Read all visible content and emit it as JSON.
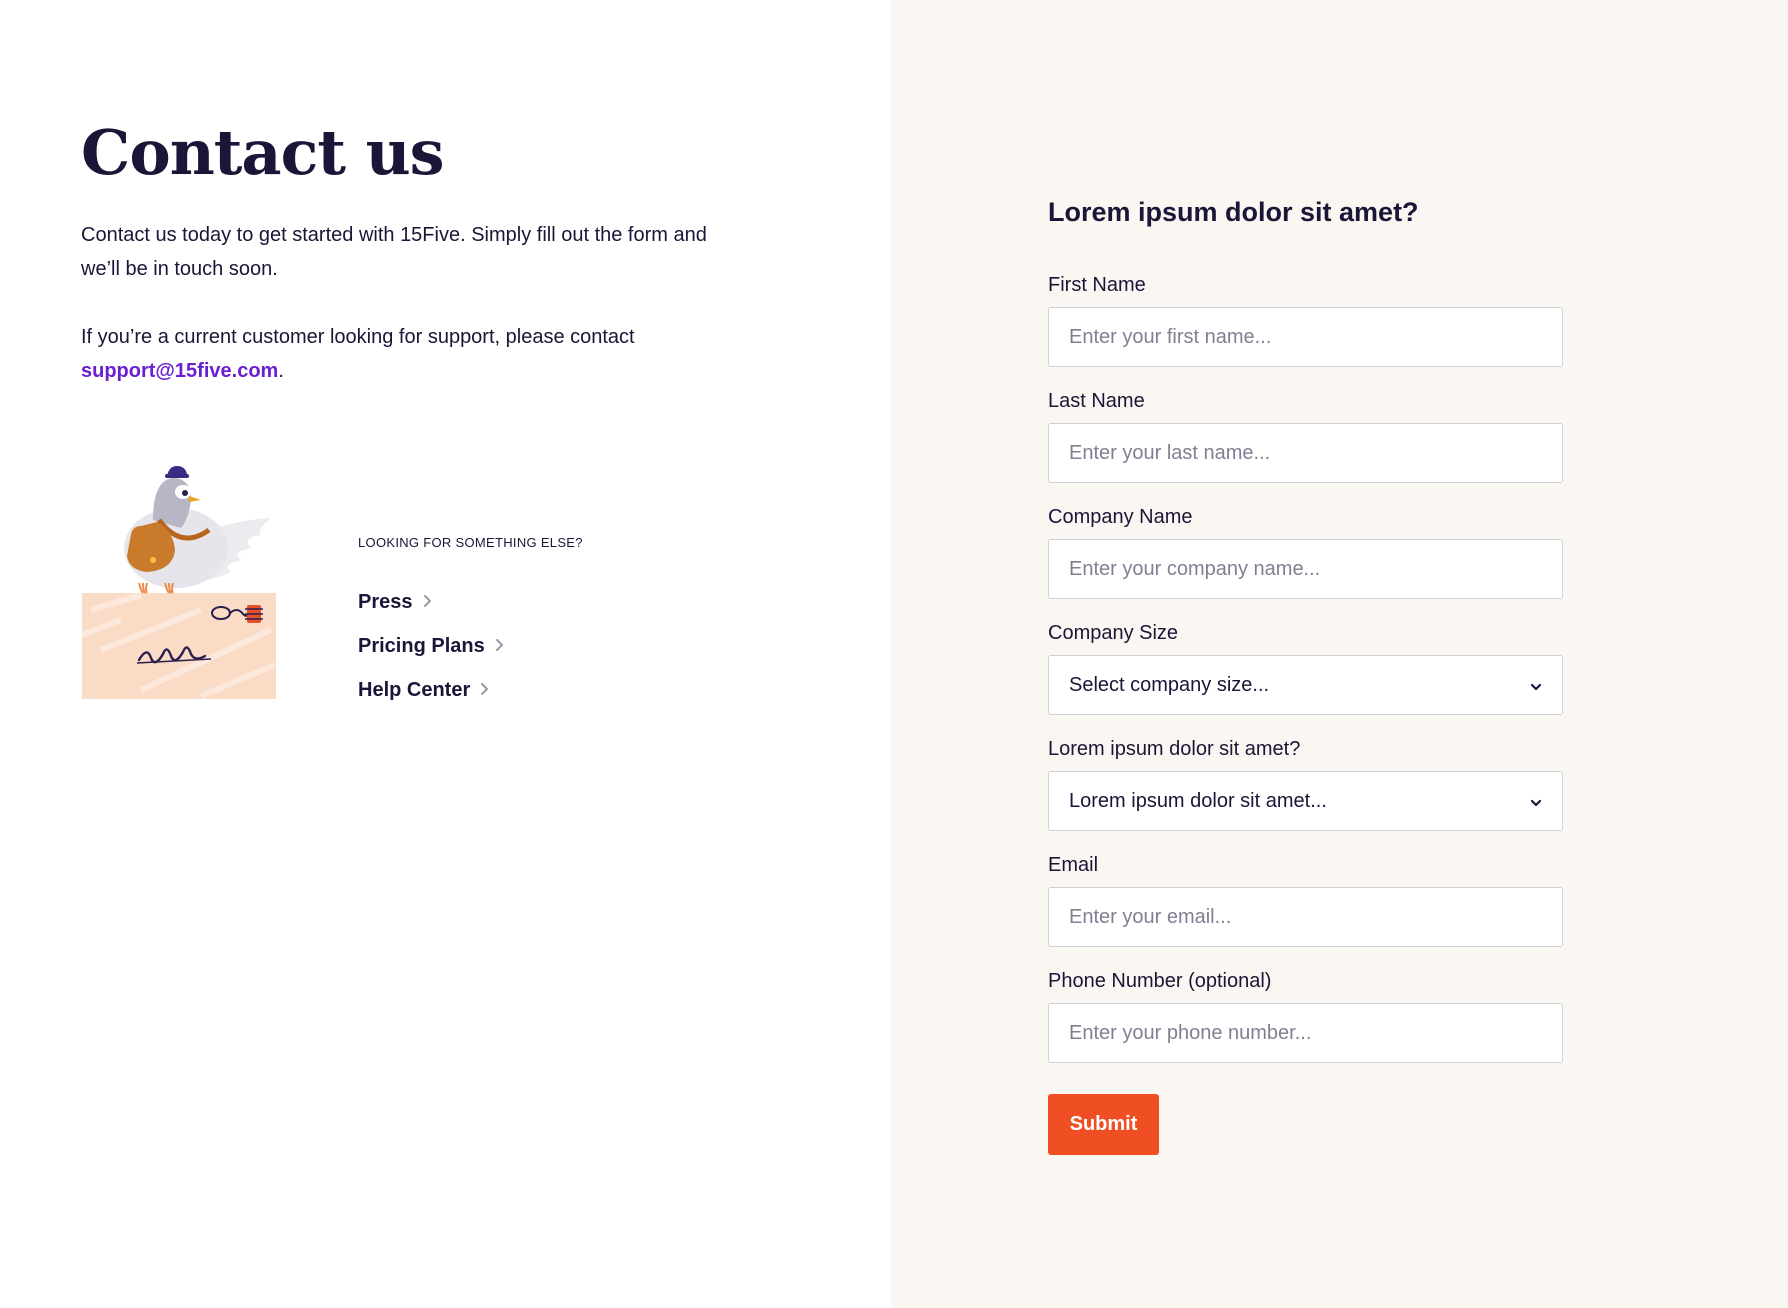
{
  "contact": {
    "title": "Contact us",
    "intro": "Contact us today to get started with 15Five. Simply fill out the form and we’ll be in touch soon.",
    "support_prefix": "If you’re a current customer looking for support, please contact ",
    "support_email": "support@15five.com",
    "support_suffix": "."
  },
  "more": {
    "heading": "LOOKING FOR SOMETHING ELSE?",
    "links": [
      {
        "label": "Press"
      },
      {
        "label": "Pricing Plans"
      },
      {
        "label": "Help Center"
      }
    ]
  },
  "form": {
    "heading": "Lorem ipsum dolor sit amet?",
    "first_name": {
      "label": "First Name",
      "placeholder": "Enter your first name..."
    },
    "last_name": {
      "label": "Last Name",
      "placeholder": "Enter your last name..."
    },
    "company_name": {
      "label": "Company Name",
      "placeholder": "Enter your company name..."
    },
    "company_size": {
      "label": "Company Size",
      "value": "Select company size..."
    },
    "question": {
      "label": "Lorem ipsum dolor sit amet?",
      "value": "Lorem ipsum dolor sit amet..."
    },
    "email": {
      "label": "Email",
      "placeholder": "Enter your email..."
    },
    "phone": {
      "label": "Phone Number (optional)",
      "placeholder": "Enter your phone number..."
    },
    "submit_label": "Submit"
  },
  "colors": {
    "text": "#1b1537",
    "link": "#6a1fd1",
    "accent": "#f04e23",
    "panel_bg": "#faf6f1",
    "field_border": "#cfd0d8"
  },
  "icons": {
    "link_chevron": "chevron-right-icon",
    "select_chevron": "chevron-down-icon",
    "illustration": "pigeon-mail-illustration"
  }
}
